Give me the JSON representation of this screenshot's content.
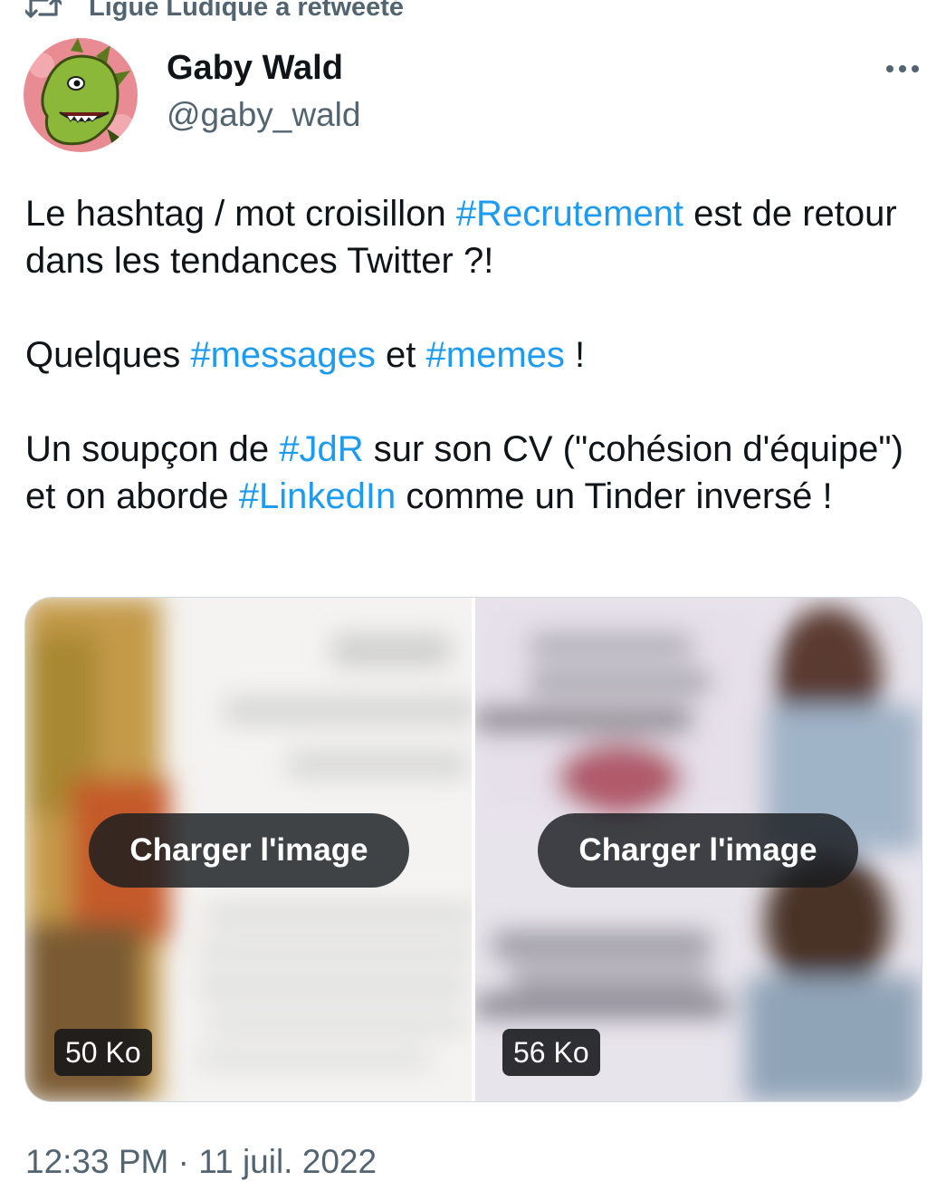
{
  "retweet": {
    "label": "Ligue Ludique a retweeté",
    "icon": "retweet-icon"
  },
  "author": {
    "name": "Gaby Wald",
    "handle": "@gaby_wald",
    "avatar": "dragon-avatar"
  },
  "more_icon": "more-dots-icon",
  "tweet": {
    "p1": {
      "t1": "Le hashtag / mot croisillon ",
      "h1": "#Recrutement",
      "t2": " est de retour dans les tendances Twitter ?!"
    },
    "p2": {
      "t1": "Quelques ",
      "h1": "#messages",
      "t2": " et ",
      "h2": "#memes",
      "t3": " !"
    },
    "p3": {
      "t1": "Un soupçon de ",
      "h1": "#JdR",
      "t2": " sur son CV (\"cohésion d'équipe\") et on aborde ",
      "h2": "#LinkedIn",
      "t3": " comme un Tinder inversé !"
    }
  },
  "media": [
    {
      "button_label": "Charger l'image",
      "size": "50 Ko"
    },
    {
      "button_label": "Charger l'image",
      "size": "56 Ko"
    }
  ],
  "timestamp": "12:33 PM · 11 juil. 2022",
  "colors": {
    "hashtag": "#1d9bf0",
    "secondary_text": "#536471",
    "primary_text": "#0f1419"
  }
}
